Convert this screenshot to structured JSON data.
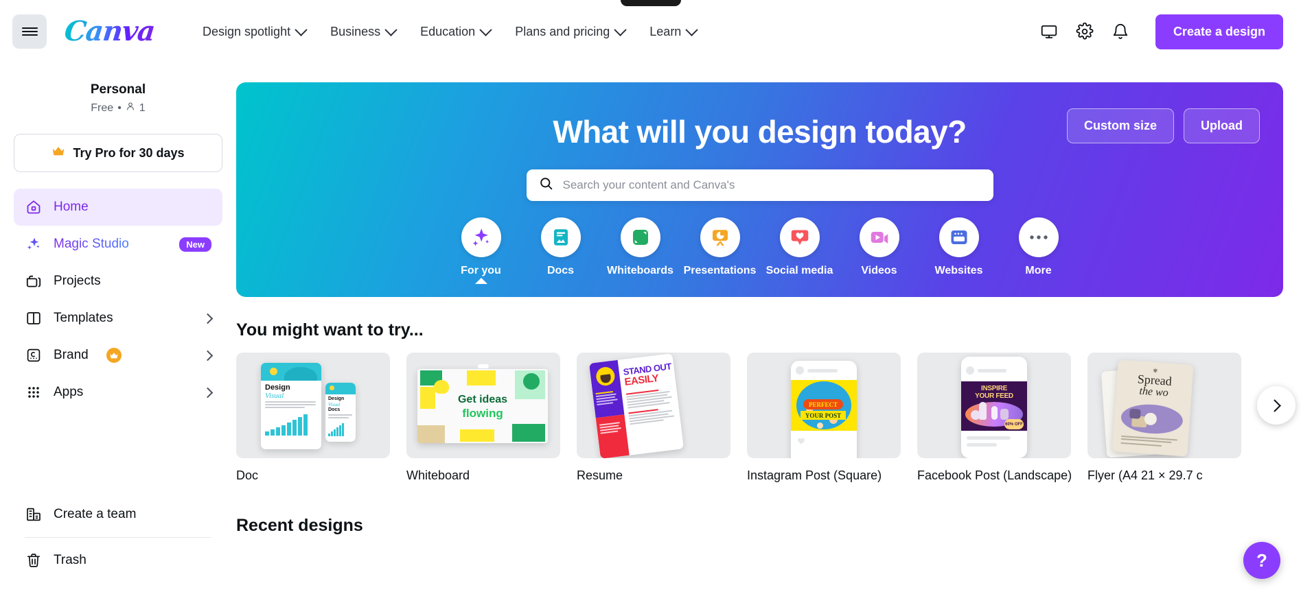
{
  "header": {
    "menu_icon": "hamburger-icon",
    "logo_text": "Canva",
    "nav": [
      {
        "label": "Design spotlight",
        "icon": "chevron-down-icon"
      },
      {
        "label": "Business",
        "icon": "chevron-down-icon"
      },
      {
        "label": "Education",
        "icon": "chevron-down-icon"
      },
      {
        "label": "Plans and pricing",
        "icon": "chevron-down-icon"
      },
      {
        "label": "Learn",
        "icon": "chevron-down-icon"
      }
    ],
    "actions": [
      {
        "icon": "monitor-icon",
        "name": "display-button"
      },
      {
        "icon": "gear-icon",
        "name": "settings-button"
      },
      {
        "icon": "bell-icon",
        "name": "notifications-button"
      }
    ],
    "cta_label": "Create a design",
    "cta_color": "#8b3dff"
  },
  "sidebar": {
    "account_name": "Personal",
    "account_plan": "Free",
    "account_separator": "•",
    "account_members": "1",
    "try_pro_label": "Try Pro for 30 days",
    "items": [
      {
        "label": "Home",
        "icon": "home-icon",
        "active": true,
        "badge": "",
        "chevron": false
      },
      {
        "label": "Magic Studio",
        "icon": "sparkle-icon",
        "active": false,
        "badge": "New",
        "chevron": false
      },
      {
        "label": "Projects",
        "icon": "folder-icon",
        "active": false,
        "badge": "",
        "chevron": false
      },
      {
        "label": "Templates",
        "icon": "template-icon",
        "active": false,
        "badge": "",
        "chevron": true
      },
      {
        "label": "Brand",
        "icon": "brand-icon",
        "active": false,
        "badge": "crown",
        "chevron": true
      },
      {
        "label": "Apps",
        "icon": "apps-grid-icon",
        "active": false,
        "badge": "",
        "chevron": true
      }
    ],
    "bottom_items": [
      {
        "label": "Create a team",
        "icon": "building-icon"
      },
      {
        "label": "Trash",
        "icon": "trash-icon"
      }
    ]
  },
  "hero": {
    "title": "What will you design today?",
    "custom_size_label": "Custom size",
    "upload_label": "Upload",
    "search_placeholder": "Search your content and Canva's",
    "search_value": "",
    "search_icon": "search-icon",
    "gradient_from": "#00c4cc",
    "gradient_to": "#7d2ae8",
    "categories": [
      {
        "label": "For you",
        "icon": "sparkle-icon",
        "color": "#8b3dff",
        "selected": true
      },
      {
        "label": "Docs",
        "icon": "document-icon",
        "color": "#14b5c4",
        "selected": false
      },
      {
        "label": "Whiteboards",
        "icon": "whiteboard-icon",
        "color": "#22ab63",
        "selected": false
      },
      {
        "label": "Presentations",
        "icon": "presentation-icon",
        "color": "#f5a623",
        "selected": false
      },
      {
        "label": "Social media",
        "icon": "heart-chat-icon",
        "color": "#f9545b",
        "selected": false
      },
      {
        "label": "Videos",
        "icon": "video-camera-icon",
        "color": "#e07ae0",
        "selected": false
      },
      {
        "label": "Websites",
        "icon": "browser-icon",
        "color": "#4a6ee0",
        "selected": false
      },
      {
        "label": "More",
        "icon": "ellipsis-icon",
        "color": "#5a5f6b",
        "selected": false
      }
    ]
  },
  "try_section": {
    "title": "You might want to try...",
    "next_icon": "chevron-right-icon",
    "cards": [
      {
        "label": "Doc",
        "art": "doc"
      },
      {
        "label": "Whiteboard",
        "art": "whiteboard"
      },
      {
        "label": "Resume",
        "art": "resume"
      },
      {
        "label": "Instagram Post (Square)",
        "art": "instagram"
      },
      {
        "label": "Facebook Post (Landscape)",
        "art": "facebook"
      },
      {
        "label": "Flyer (A4 21 × 29.7 c",
        "art": "flyer"
      }
    ],
    "art_text": {
      "doc_title_1": "Design",
      "doc_title_2": "Visual",
      "doc_title_3": "Docs",
      "whiteboard_1": "Get ideas",
      "whiteboard_2": "flowing",
      "resume_1": "STAND OUT",
      "resume_2": "EASILY",
      "instagram_1": "PERFECT",
      "instagram_2": "YOUR POST",
      "facebook_1": "INSPIRE",
      "facebook_2": "YOUR FEED",
      "facebook_3": "60% OFF",
      "flyer_1": "Spread",
      "flyer_2": "the wo"
    }
  },
  "recent_section": {
    "title": "Recent designs"
  },
  "help": {
    "label": "?",
    "color": "#8b3dff"
  }
}
